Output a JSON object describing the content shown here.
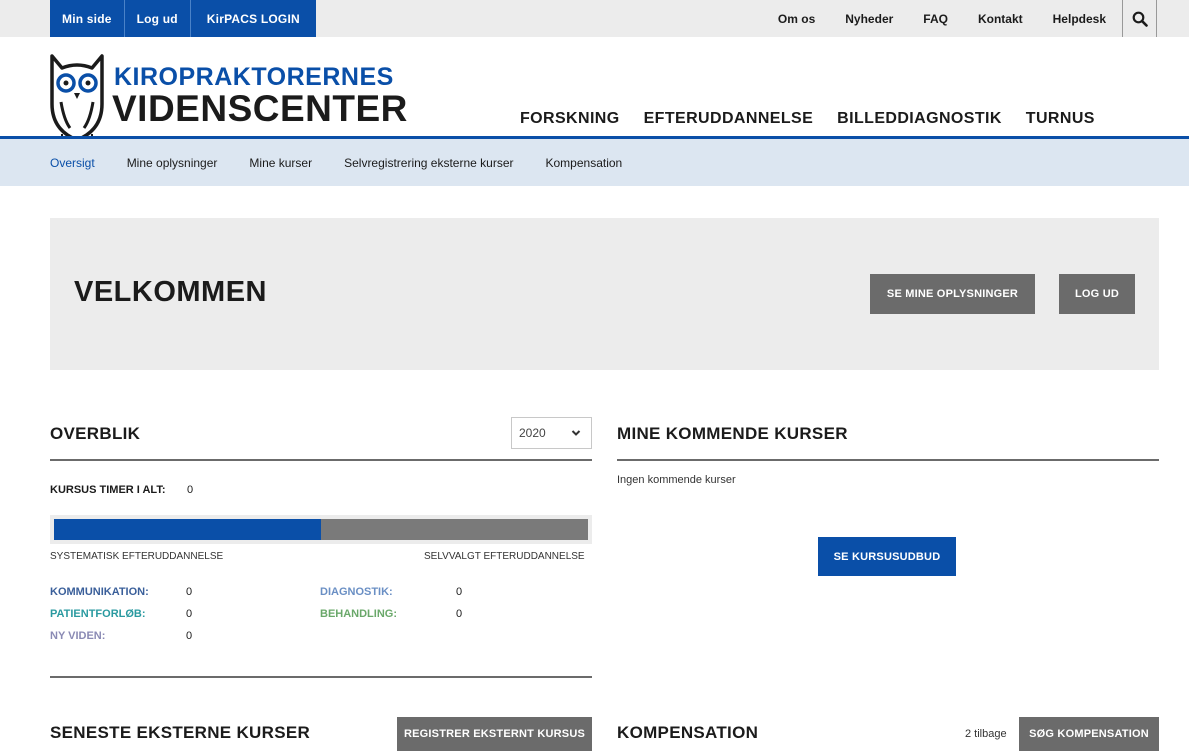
{
  "topbar": {
    "buttons": [
      "Min side",
      "Log ud",
      "KirPACS LOGIN"
    ],
    "links": [
      "Om os",
      "Nyheder",
      "FAQ",
      "Kontakt",
      "Helpdesk"
    ]
  },
  "logo": {
    "line1": "KIROPRAKTORERNES",
    "line2": "VIDENSCENTER"
  },
  "mainnav": [
    {
      "label": "FORSKNING",
      "color": "#3a8f3a"
    },
    {
      "label": "EFTERUDDANNELSE",
      "color": "#e07a1c"
    },
    {
      "label": "BILLEDDIAGNOSTIK",
      "color": "#6a2a9a"
    },
    {
      "label": "TURNUS",
      "color": "#c0243c"
    }
  ],
  "subnav": [
    "Oversigt",
    "Mine oplysninger",
    "Mine kurser",
    "Selvregistrering eksterne kurser",
    "Kompensation"
  ],
  "welcome": {
    "title": "VELKOMMEN",
    "btn_info": "SE MINE OPLYSNINGER",
    "btn_logout": "LOG UD"
  },
  "overblik": {
    "title": "OVERBLIK",
    "year": "2020",
    "hours_label": "KURSUS TIMER I ALT:",
    "hours_value": "0",
    "systematic_fraction": 0.5,
    "left_caption": "SYSTEMATISK EFTERUDDANNELSE",
    "right_caption": "SELVVALGT EFTERUDDANNELSE",
    "stats": [
      {
        "label": "KOMMUNIKATION:",
        "value": "0",
        "color": "#3a5f9a"
      },
      {
        "label": "DIAGNOSTIK:",
        "value": "0",
        "color": "#6a8fc4"
      },
      {
        "label": "PATIENTFORLØB:",
        "value": "0",
        "color": "#2a9aa0"
      },
      {
        "label": "BEHANDLING:",
        "value": "0",
        "color": "#6aa86a"
      },
      {
        "label": "NY VIDEN:",
        "value": "0",
        "color": "#8a8ab4"
      }
    ]
  },
  "kommende": {
    "title": "MINE KOMMENDE KURSER",
    "empty": "Ingen kommende kurser",
    "btn": "SE KURSUSUDBUD"
  },
  "eksterne": {
    "title": "SENESTE EKSTERNE KURSER",
    "btn": "REGISTRER EKSTERNT KURSUS"
  },
  "kompensation": {
    "title": "KOMPENSATION",
    "remaining": "2 tilbage",
    "btn": "SØG KOMPENSATION"
  }
}
